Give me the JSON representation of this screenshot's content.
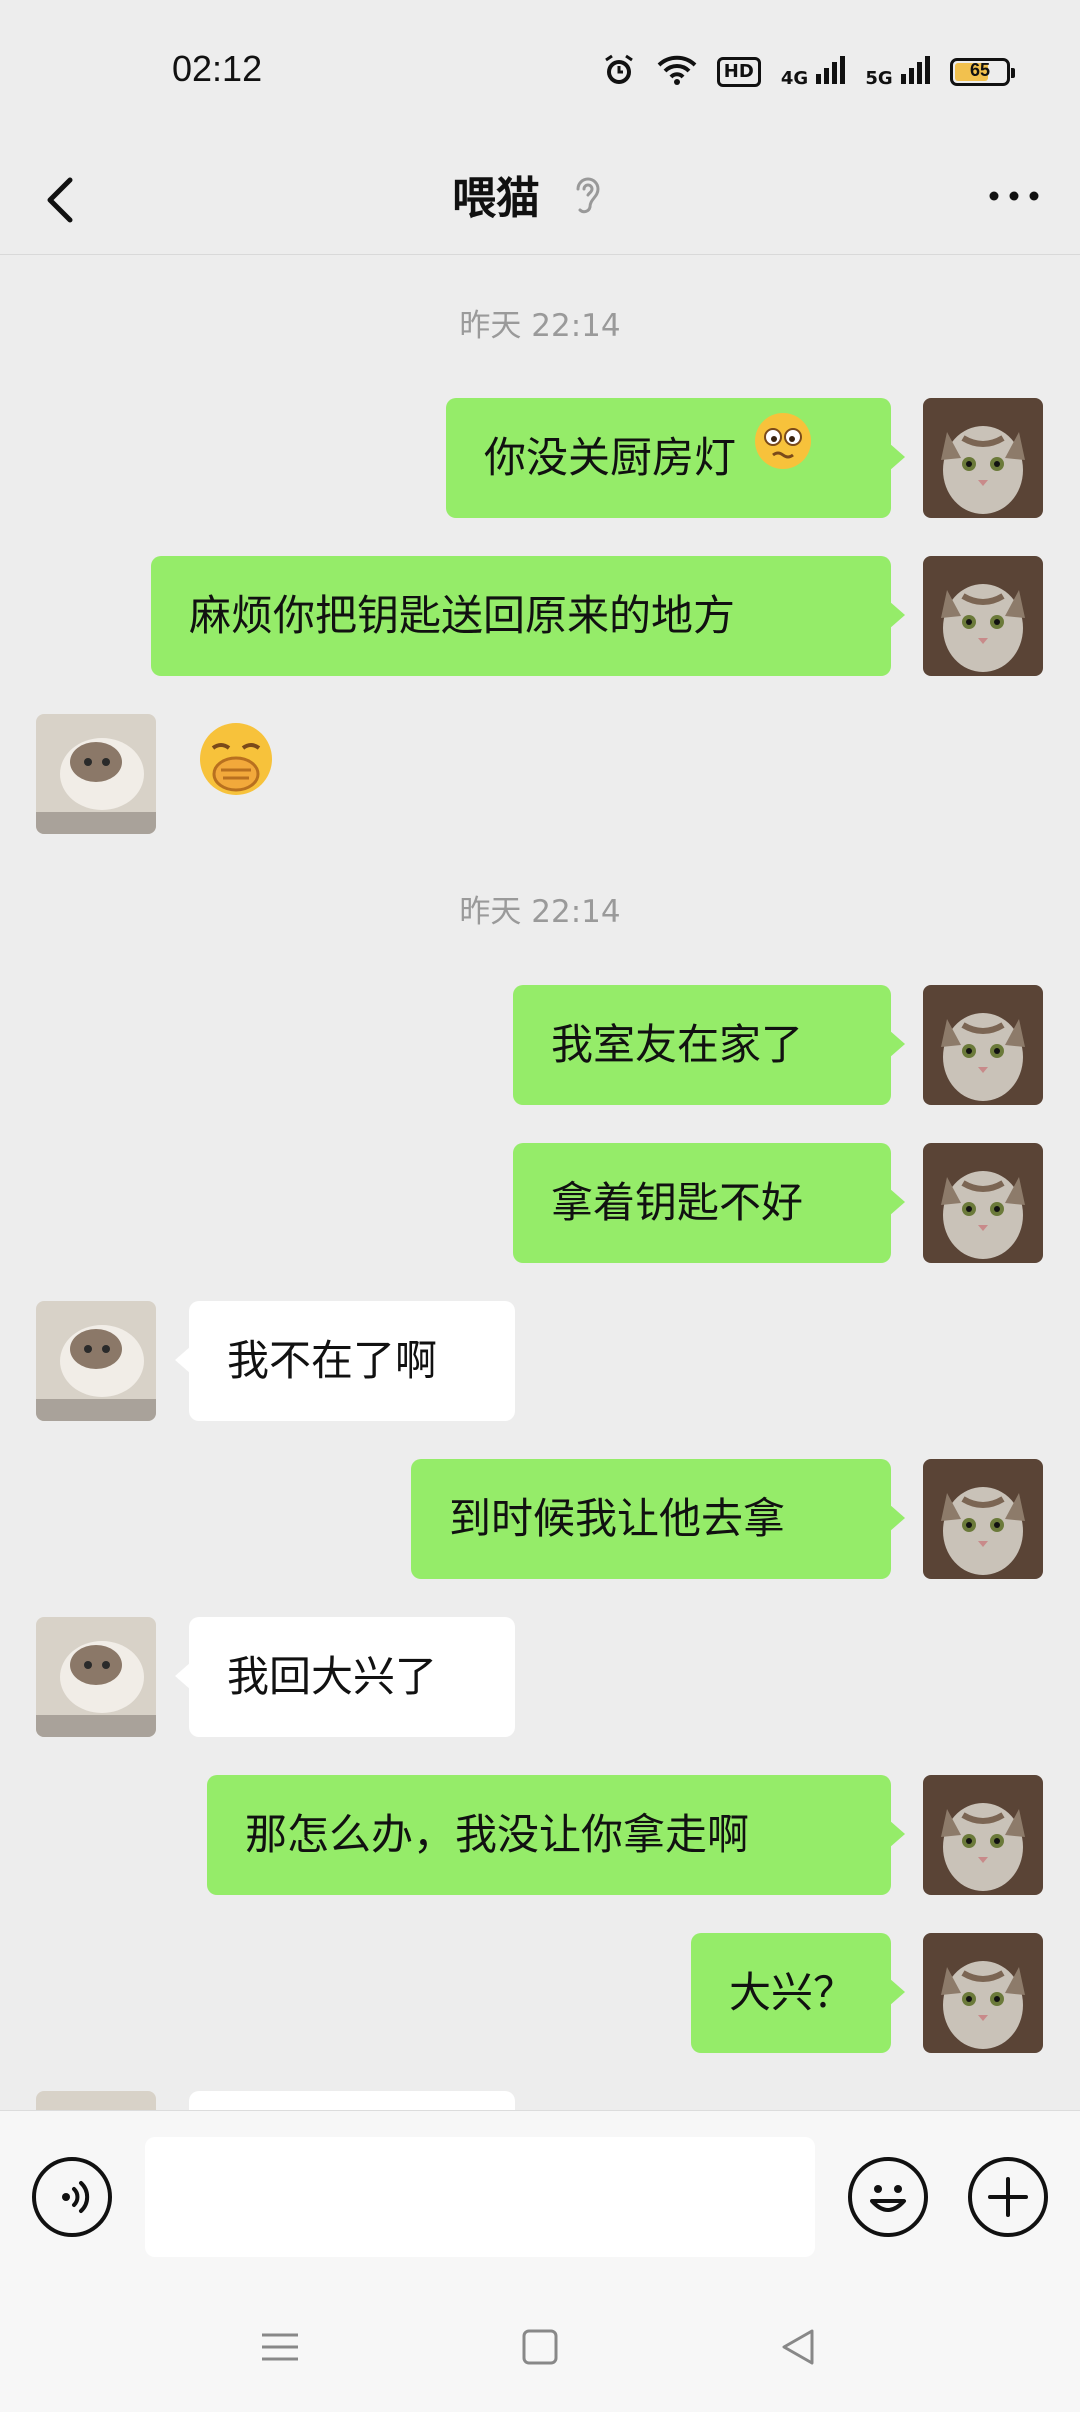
{
  "status_bar": {
    "time": "02:12",
    "icons": [
      "alarm-icon",
      "wifi-icon",
      "hd-icon",
      "signal-4g-icon",
      "signal-5g-icon",
      "battery-icon"
    ],
    "hd_label": "HD",
    "net1_label": "4G",
    "net2_label": "5G",
    "battery": "65"
  },
  "header": {
    "back_icon": "chevron-left-icon",
    "title": "喂猫",
    "earpiece_icon": "ear-icon",
    "more_icon": "more-icon"
  },
  "chat": {
    "timestamps": [
      "昨天 22:14",
      "昨天 22:14"
    ],
    "messages": [
      {
        "from": "me",
        "text": "你没关厨房灯",
        "emoji": "woozy-face-emoji"
      },
      {
        "from": "me",
        "text": "麻烦你把钥匙送回原来的地方"
      },
      {
        "from": "other",
        "text": "",
        "emoji": "facepalm-emoji"
      },
      {
        "from": "me",
        "text": "我室友在家了"
      },
      {
        "from": "me",
        "text": "拿着钥匙不好"
      },
      {
        "from": "other",
        "text": "我不在了啊"
      },
      {
        "from": "me",
        "text": "到时候我让他去拿"
      },
      {
        "from": "other",
        "text": "我回大兴了"
      },
      {
        "from": "me",
        "text": "那怎么办，我没让你拿走啊"
      },
      {
        "from": "me",
        "text": "大兴？"
      },
      {
        "from": "other",
        "text": ""
      }
    ]
  },
  "input_bar": {
    "voice_icon": "voice-icon",
    "text_value": "",
    "emoji_icon": "emoji-icon",
    "plus_icon": "plus-icon"
  },
  "nav_bar": {
    "icons": [
      "menu-icon",
      "home-icon",
      "back-icon"
    ]
  },
  "colors": {
    "my_bubble": "#95ec69",
    "other_bubble": "#ffffff",
    "background": "#ededed"
  }
}
